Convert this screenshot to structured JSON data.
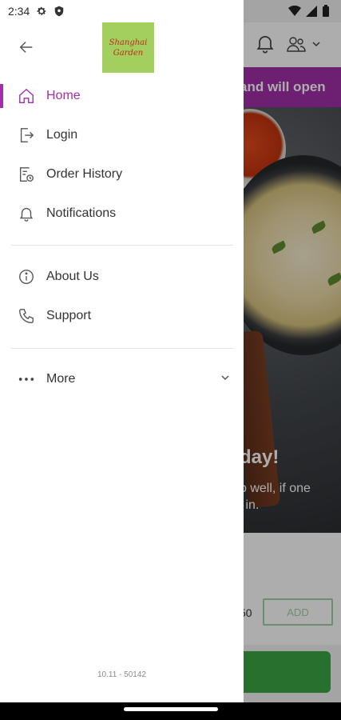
{
  "status_bar": {
    "time": "2:34"
  },
  "drawer": {
    "logo_line1": "Shanghai",
    "logo_line2": "Garden",
    "items": [
      {
        "label": "Home",
        "icon": "home-icon",
        "active": true
      },
      {
        "label": "Login",
        "icon": "login-icon"
      },
      {
        "label": "Order History",
        "icon": "order-history-icon"
      },
      {
        "label": "Notifications",
        "icon": "bell-icon"
      },
      {
        "label": "About Us",
        "icon": "info-icon"
      },
      {
        "label": "Support",
        "icon": "phone-icon"
      },
      {
        "label": "More",
        "icon": "more-dots-icon"
      }
    ],
    "version": "10.11 - 50142"
  },
  "background": {
    "banner_text": "and will open",
    "hero_heading": "day!",
    "hero_sub": "p well, if one\n' in.",
    "price_fragment": "50",
    "add_label": "ADD"
  },
  "colors": {
    "accent": "#a12fa8",
    "logo_bg": "#a3cf5e",
    "logo_text": "#c02a1a",
    "add_border": "#9fd0a5",
    "cta_green": "#3aa545"
  }
}
